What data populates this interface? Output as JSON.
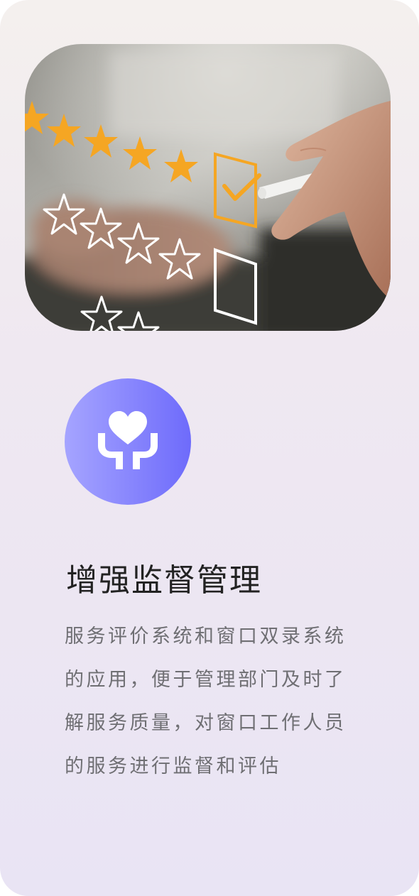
{
  "card": {
    "title": "增强监督管理",
    "description": "服务评价系统和窗口双录系统的应用，便于管理部门及时了解服务质量，对窗口工作人员的服务进行监督和评估"
  },
  "photo": {
    "icon": "rating-photo"
  },
  "feature_icon": {
    "icon": "heart-hands-icon"
  },
  "colors": {
    "icon_gradient_start": "#a5a4ff",
    "icon_gradient_end": "#6e6bfb",
    "star_filled": "#f5a623",
    "title_text": "#222222",
    "body_text": "#6f6f73"
  }
}
